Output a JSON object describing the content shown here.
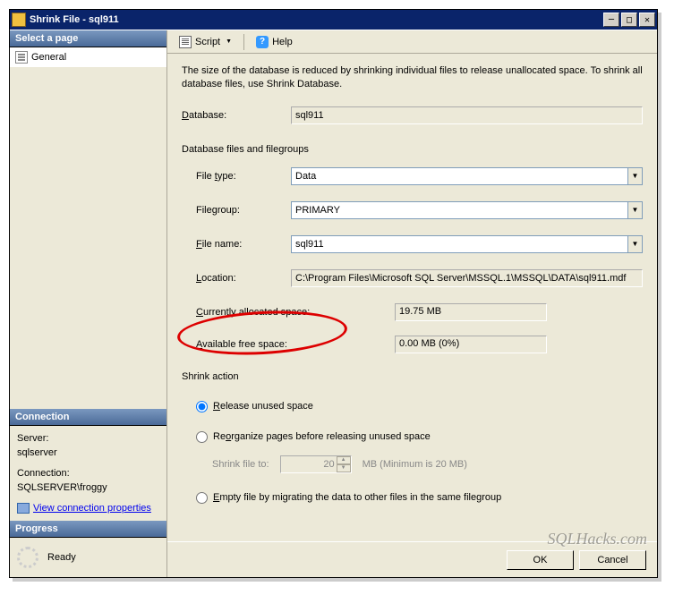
{
  "title": "Shrink File - sql911",
  "leftpanel": {
    "select_page": "Select a page",
    "general": "General",
    "connection_header": "Connection",
    "server_label": "Server:",
    "server_value": "sqlserver",
    "connection_label": "Connection:",
    "connection_value": "SQLSERVER\\froggy",
    "view_conn_link": "View connection properties",
    "progress_header": "Progress",
    "progress_status": "Ready"
  },
  "toolbar": {
    "script": "Script",
    "help": "Help"
  },
  "main": {
    "description": "The size of the database is reduced by shrinking individual files to release unallocated space. To shrink all database files, use Shrink Database.",
    "database_label": "Database:",
    "database_value": "sql911",
    "db_files_label": "Database files and filegroups",
    "filetype_label": "File type:",
    "filetype_value": "Data",
    "filegroup_label": "Filegroup:",
    "filegroup_value": "PRIMARY",
    "filename_label": "File name:",
    "filename_value": "sql911",
    "location_label": "Location:",
    "location_value": "C:\\Program Files\\Microsoft SQL Server\\MSSQL.1\\MSSQL\\DATA\\sql911.mdf",
    "allocated_label": "Currently allocated space:",
    "allocated_value": "19.75 MB",
    "available_label": "Available free space:",
    "available_value": "0.00 MB (0%)",
    "shrink_action_label": "Shrink action",
    "radio_release": "Release unused space",
    "radio_reorganize": "Reorganize pages before releasing unused space",
    "shrink_file_to": "Shrink file to:",
    "shrink_value": "20",
    "shrink_suffix": "MB (Minimum is 20 MB)",
    "radio_empty": "Empty file by migrating the data to other files in the same filegroup"
  },
  "buttons": {
    "ok": "OK",
    "cancel": "Cancel"
  },
  "watermark": "SQLHacks.com"
}
